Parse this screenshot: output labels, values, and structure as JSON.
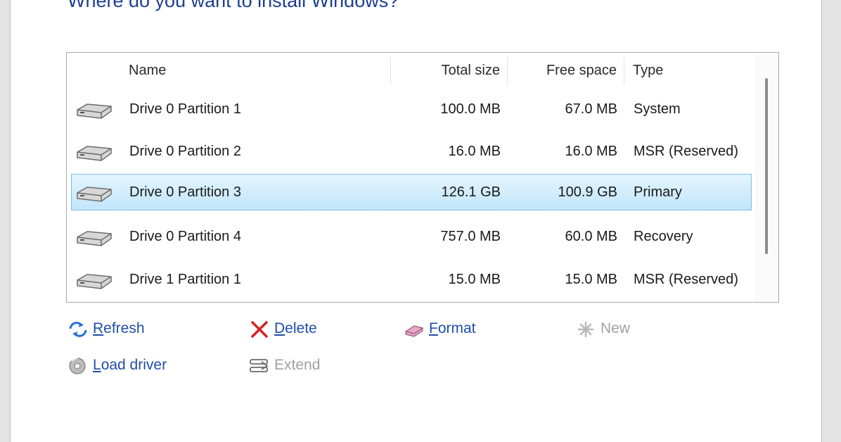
{
  "heading": "Where do you want to install Windows?",
  "columns": {
    "name": "Name",
    "total_size": "Total size",
    "free_space": "Free space",
    "type": "Type"
  },
  "partitions": [
    {
      "name": "Drive 0 Partition 1",
      "total": "100.0 MB",
      "free": "67.0 MB",
      "type": "System",
      "selected": false
    },
    {
      "name": "Drive 0 Partition 2",
      "total": "16.0 MB",
      "free": "16.0 MB",
      "type": "MSR (Reserved)",
      "selected": false
    },
    {
      "name": "Drive 0 Partition 3",
      "total": "126.1 GB",
      "free": "100.9 GB",
      "type": "Primary",
      "selected": true
    },
    {
      "name": "Drive 0 Partition 4",
      "total": "757.0 MB",
      "free": "60.0 MB",
      "type": "Recovery",
      "selected": false
    },
    {
      "name": "Drive 1 Partition 1",
      "total": "15.0 MB",
      "free": "15.0 MB",
      "type": "MSR (Reserved)",
      "selected": false
    }
  ],
  "actions": {
    "refresh": {
      "label": "Refresh",
      "icon": "refresh-icon",
      "enabled": true
    },
    "delete": {
      "label": "Delete",
      "icon": "delete-icon",
      "enabled": true
    },
    "format": {
      "label": "Format",
      "icon": "format-icon",
      "enabled": true
    },
    "new": {
      "label": "New",
      "icon": "new-icon",
      "enabled": false
    },
    "load_driver": {
      "label": "Load driver",
      "icon": "load-driver-icon",
      "enabled": true
    },
    "extend": {
      "label": "Extend",
      "icon": "extend-icon",
      "enabled": false
    }
  },
  "colors": {
    "heading": "#1e3f8f",
    "link": "#1e4ea8",
    "selection": "#c2e6fb",
    "disabled": "#a0a0a0"
  }
}
